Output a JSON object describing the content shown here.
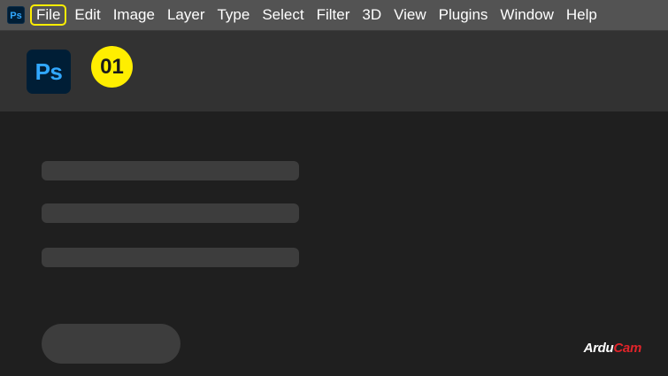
{
  "menubar": {
    "app_icon_label": "Ps",
    "items": [
      "File",
      "Edit",
      "Image",
      "Layer",
      "Type",
      "Select",
      "Filter",
      "3D",
      "View",
      "Plugins",
      "Window",
      "Help"
    ]
  },
  "header": {
    "logo_label": "Ps",
    "step_badge": "01"
  },
  "watermark": {
    "part1": "Ardu",
    "part2": "Cam"
  },
  "colors": {
    "menubar_bg": "#535353",
    "header_bg": "#323232",
    "main_bg": "#1f1f1f",
    "ps_blue": "#31a8ff",
    "ps_dark": "#001e36",
    "highlight_yellow": "#ffee00",
    "placeholder": "#3d3d3d"
  }
}
